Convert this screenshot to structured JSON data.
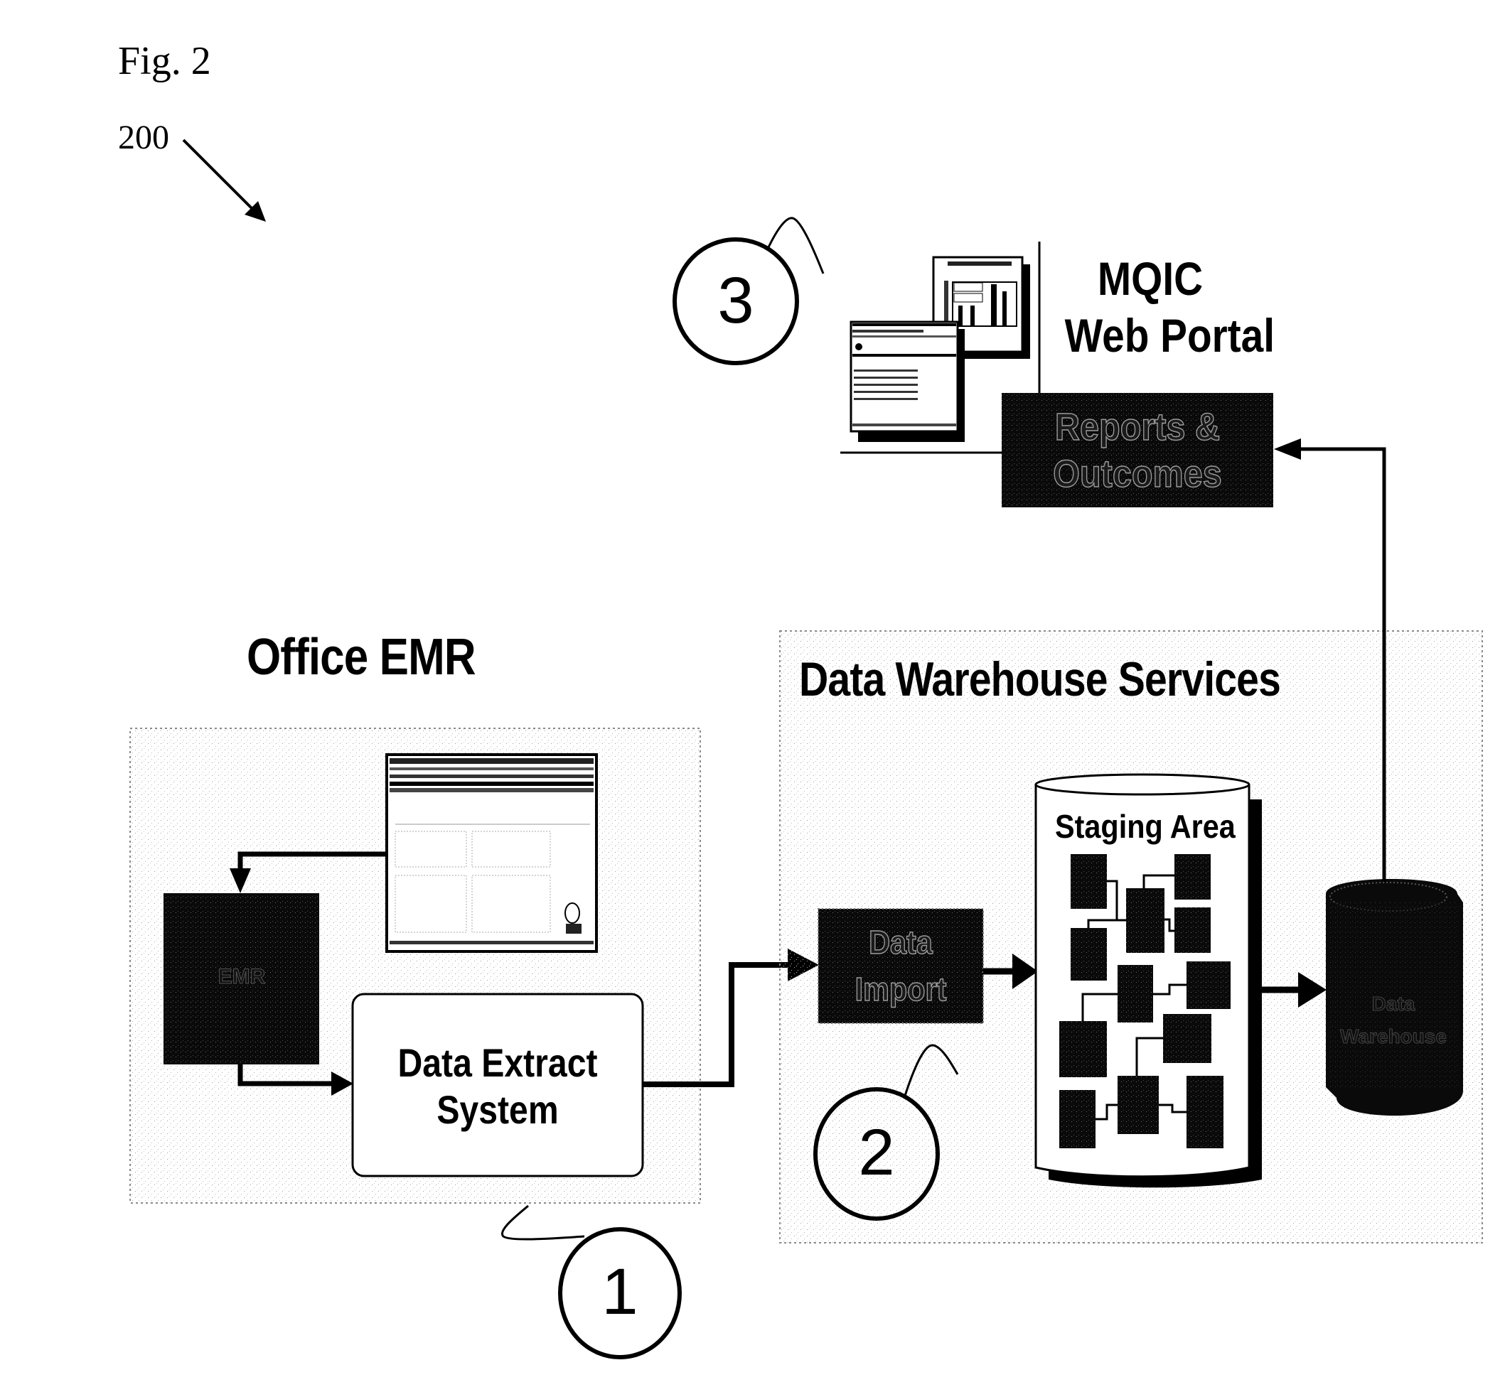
{
  "figure": {
    "title": "Fig. 2",
    "reference_numeral": "200"
  },
  "office_emr": {
    "heading": "Office EMR",
    "emr_block_label": "EMR",
    "data_extract_system": {
      "line1": "Data Extract",
      "line2": "System"
    },
    "callout_number": "1"
  },
  "data_warehouse": {
    "heading": "Data Warehouse Services",
    "data_import": {
      "line1": "Data",
      "line2": "Import"
    },
    "staging_area_label": "Staging Area",
    "warehouse_db_label_line1": "Data",
    "warehouse_db_label_line2": "Warehouse",
    "callout_number": "2"
  },
  "web_portal": {
    "heading_line1": "MQIC",
    "heading_line2": "Web Portal",
    "reports": {
      "line1": "Reports &",
      "line2": "Outcomes"
    },
    "callout_number": "3"
  },
  "colors": {
    "ink": "#000000",
    "panel_stipple": "#bdbdbd",
    "dark_block": "#111111"
  }
}
